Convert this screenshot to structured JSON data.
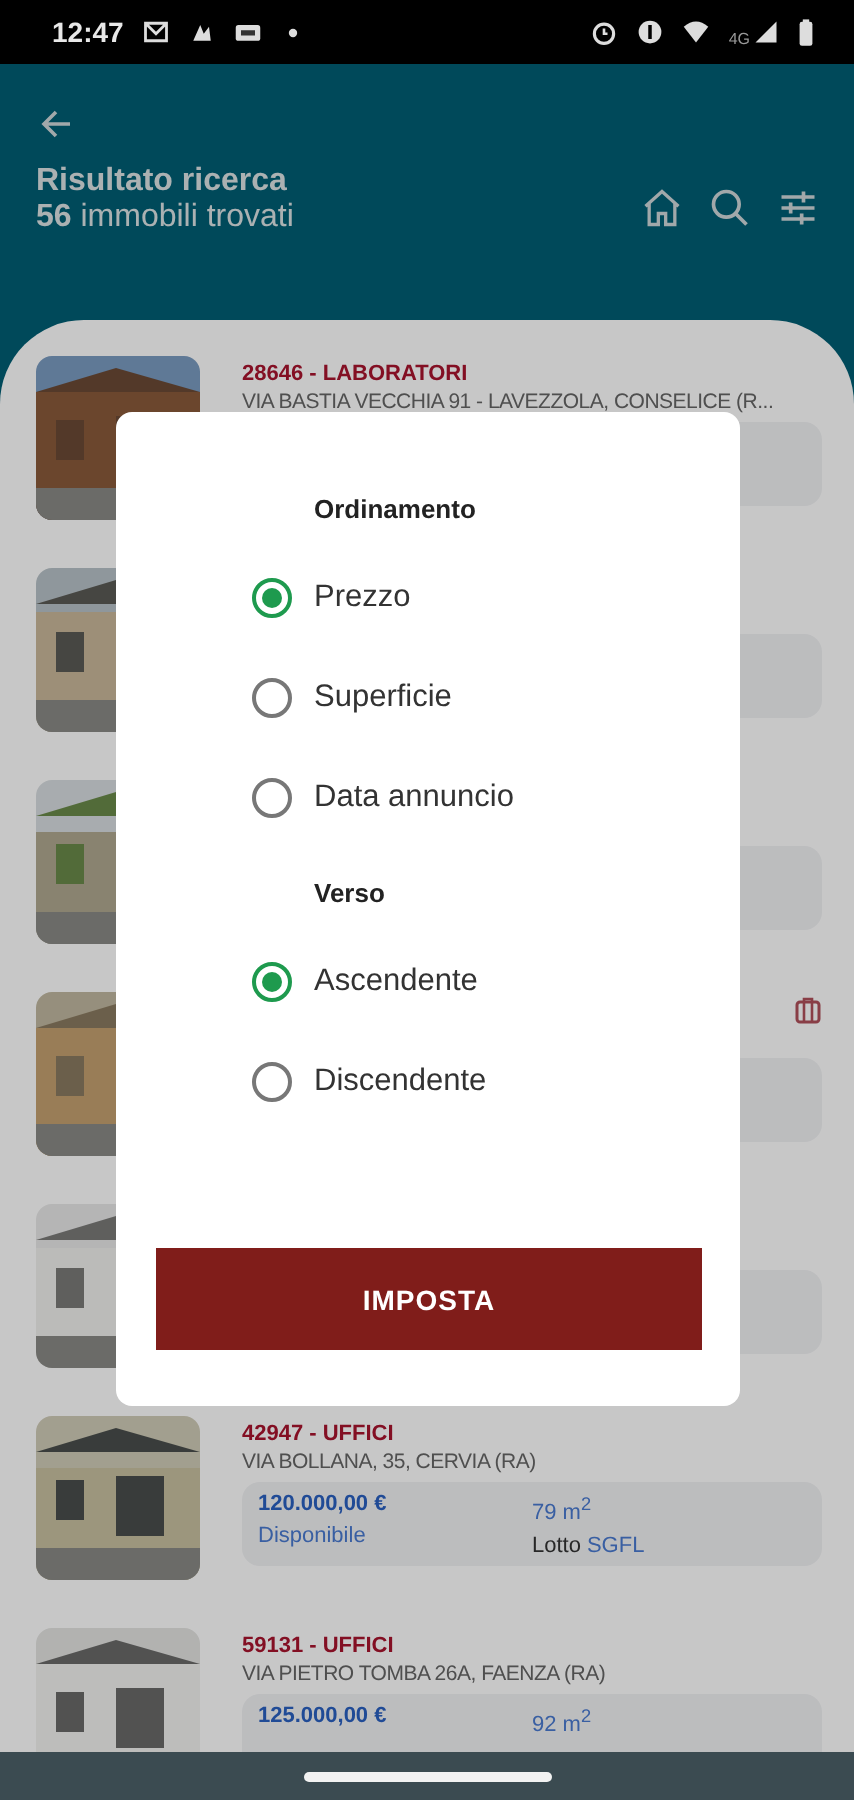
{
  "status_bar": {
    "time": "12:47",
    "network": "4G"
  },
  "header": {
    "title": "Risultato ricerca",
    "count": "56",
    "count_label": "immobili trovati"
  },
  "listings": [
    {
      "kind": "listing",
      "code": "28646 - LABORATORI",
      "address": "VIA BASTIA VECCHIA 91 - LAVEZZOLA, CONSELICE (R..."
    },
    {
      "kind": "covered"
    },
    {
      "kind": "covered"
    },
    {
      "kind": "covered",
      "flag_icon": true
    },
    {
      "kind": "covered"
    },
    {
      "kind": "listing",
      "code": "42947 - UFFICI",
      "address": "VIA BOLLANA, 35, CERVIA (RA)",
      "price": "120.000,00 €",
      "area": "79 m$^{2}$",
      "availability": "Disponibile",
      "lot_label": "Lotto",
      "lot": "SGFL"
    },
    {
      "kind": "listing",
      "code": "59131 - UFFICI",
      "address": "VIA PIETRO TOMBA 26A, FAENZA (RA)",
      "price": "125.000,00 €",
      "area": "92 m$^{2}$"
    }
  ],
  "dialog": {
    "sections": [
      {
        "title": "Ordinamento",
        "options": [
          {
            "label": "Prezzo",
            "selected": true
          },
          {
            "label": "Superficie",
            "selected": false
          },
          {
            "label": "Data annuncio",
            "selected": false
          }
        ]
      },
      {
        "title": "Verso",
        "options": [
          {
            "label": "Ascendente",
            "selected": true
          },
          {
            "label": "Discendente",
            "selected": false
          }
        ]
      }
    ],
    "button": "IMPOSTA"
  }
}
